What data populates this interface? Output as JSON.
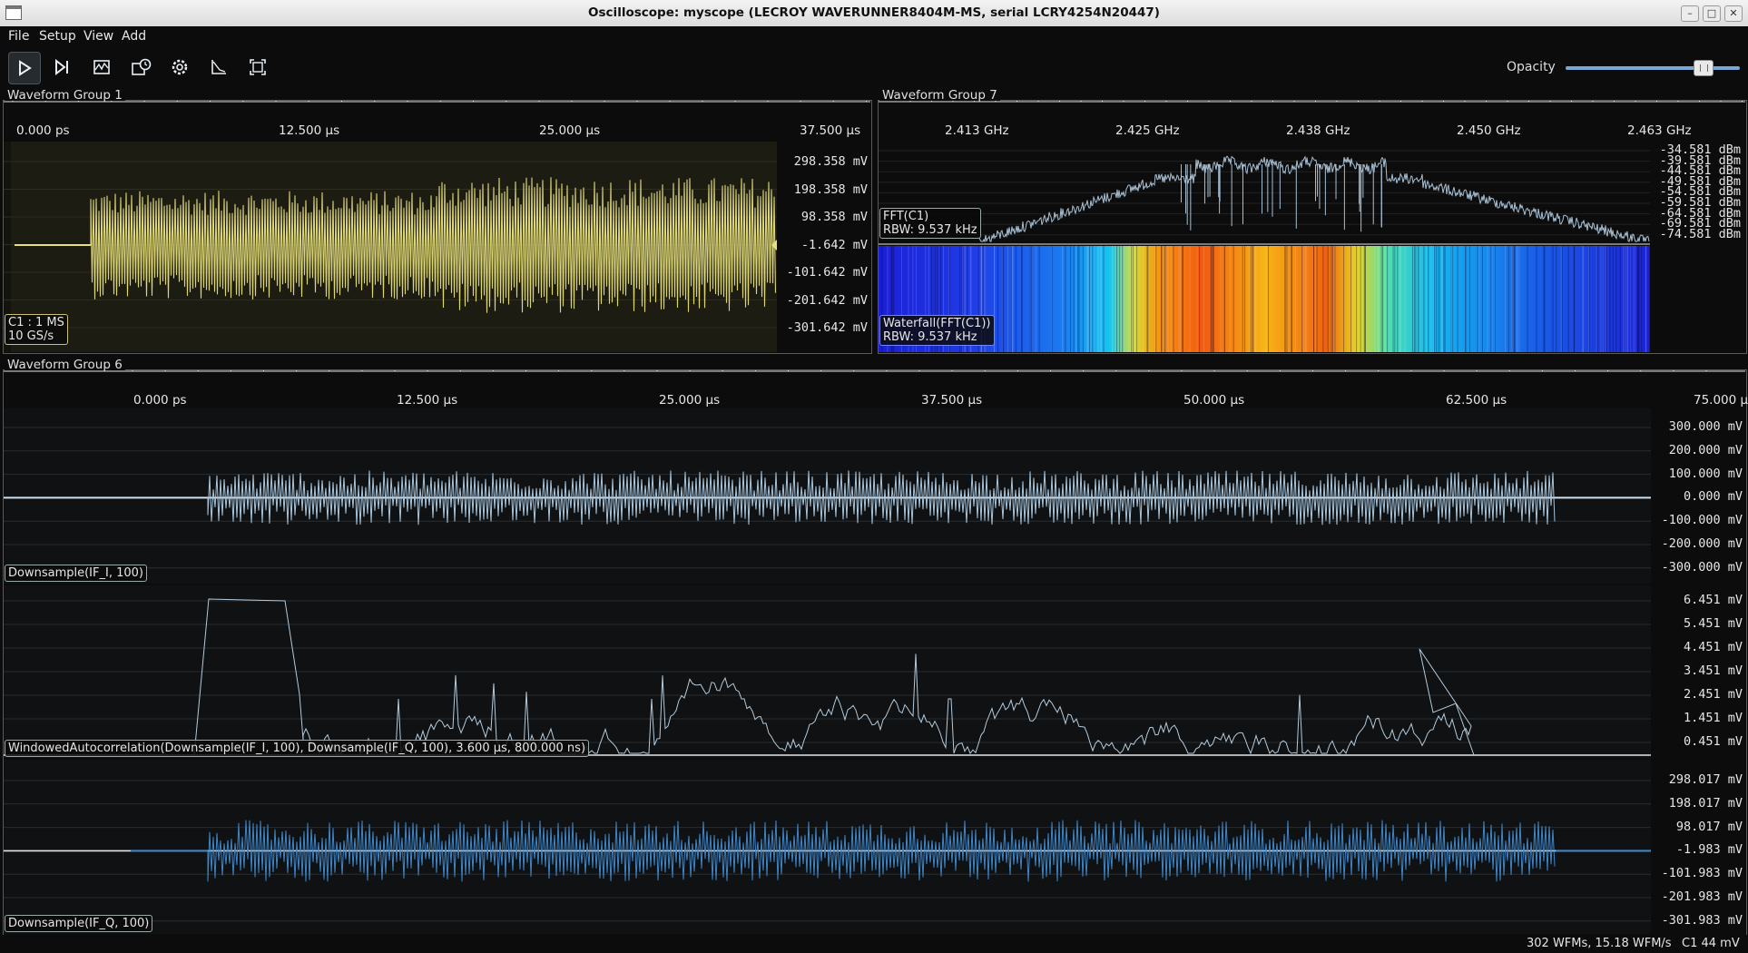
{
  "window": {
    "title": "Oscilloscope: myscope (LECROY WAVERUNNER8404M-MS, serial LCRY4254N20447)"
  },
  "menu": [
    "File",
    "Setup",
    "View",
    "Add"
  ],
  "toolbar": {
    "buttons": [
      "play-icon",
      "step-icon",
      "waveform-icon",
      "history-icon",
      "gear-icon",
      "measure-icon",
      "fullscreen-icon"
    ],
    "opacity_label": "Opacity",
    "opacity": 0.82
  },
  "group1": {
    "title": "Waveform Group 1",
    "x_ticks": [
      "0.000 ps",
      "12.500 µs",
      "25.000 µs",
      "37.500 µs"
    ],
    "y_ticks": [
      "298.358 mV",
      "198.358 mV",
      "98.358 mV",
      "-1.642 mV",
      "-101.642 mV",
      "-201.642 mV",
      "-301.642 mV"
    ],
    "channel_label": "C1 : 1 MS",
    "rate_label": "10 GS/s",
    "color": "#e8e07a"
  },
  "group7": {
    "title": "Waveform Group 7",
    "x_ticks": [
      "2.413 GHz",
      "2.425 GHz",
      "2.438 GHz",
      "2.450 GHz",
      "2.463 GHz"
    ],
    "y_ticks": [
      "-34.581 dBm",
      "-39.581 dBm",
      "-44.581 dBm",
      "-49.581 dBm",
      "-54.581 dBm",
      "-59.581 dBm",
      "-64.581 dBm",
      "-69.581 dBm",
      "-74.581 dBm"
    ],
    "fft_label": "FFT(C1)",
    "fft_rbw": "RBW: 9.537 kHz",
    "waterfall_label": "Waterfall(FFT(C1))",
    "waterfall_rbw": "RBW: 9.537 kHz"
  },
  "group6": {
    "title": "Waveform Group 6",
    "x_ticks": [
      "0.000 ps",
      "12.500 µs",
      "25.000 µs",
      "37.500 µs",
      "50.000 µs",
      "62.500 µs",
      "75.000 µs"
    ],
    "pane_i": {
      "label": "Downsample(IF_I, 100)",
      "y_ticks": [
        "300.000 mV",
        "200.000 mV",
        "100.000 mV",
        "0.000 mV",
        "-100.000 mV",
        "-200.000 mV",
        "-300.000 mV"
      ],
      "color": "#a9c6dc"
    },
    "pane_corr": {
      "label": "WindowedAutocorrelation(Downsample(IF_I, 100), Downsample(IF_Q, 100), 3.600 µs, 800.000 ns)",
      "y_ticks": [
        "6.451 mV",
        "5.451 mV",
        "4.451 mV",
        "3.451 mV",
        "2.451 mV",
        "1.451 mV",
        "0.451 mV"
      ],
      "color": "#b4cbdc"
    },
    "pane_q": {
      "label": "Downsample(IF_Q, 100)",
      "y_ticks": [
        "298.017 mV",
        "198.017 mV",
        "98.017 mV",
        "-1.983 mV",
        "-101.983 mV",
        "-201.983 mV",
        "-301.983 mV"
      ],
      "color": "#3f86c8"
    }
  },
  "status": {
    "rate": "302 WFMs, 15.18 WFM/s",
    "channel": "C1 44 mV"
  }
}
